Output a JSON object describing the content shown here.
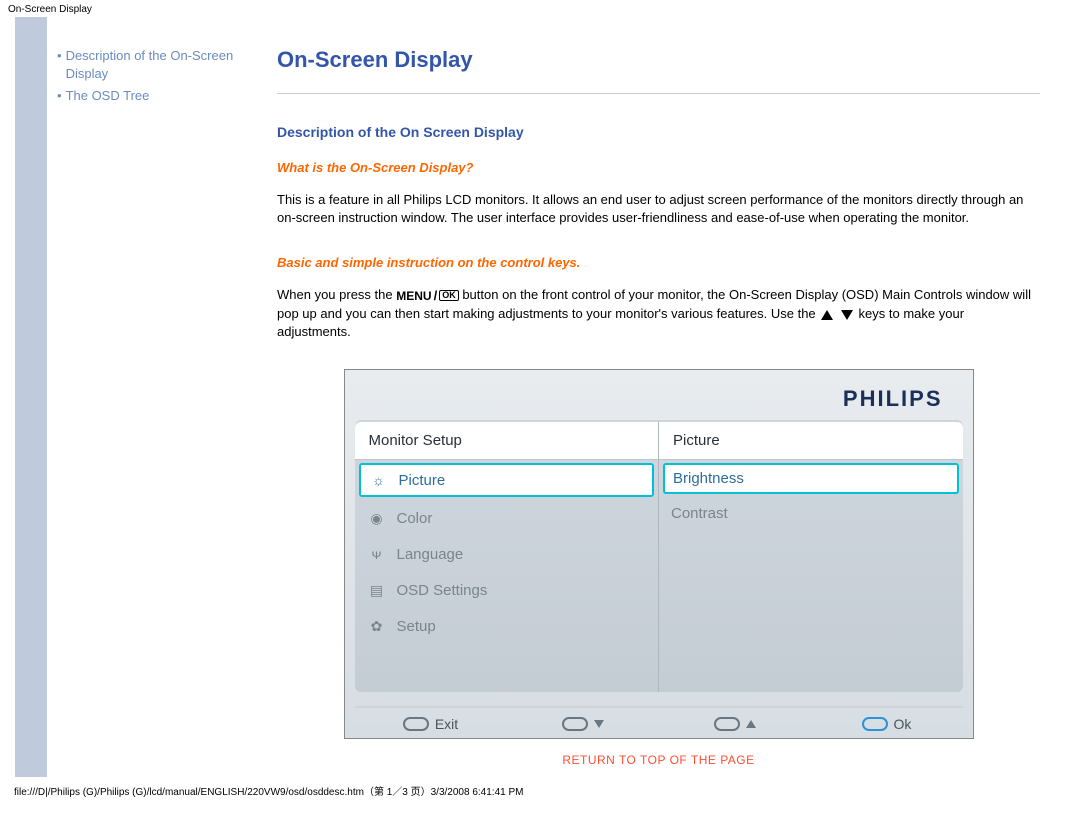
{
  "top_label": "On-Screen Display",
  "sidebar": {
    "items": [
      {
        "label": "Description of the On-Screen Display"
      },
      {
        "label": "The OSD Tree"
      }
    ]
  },
  "main": {
    "title": "On-Screen Display",
    "desc_heading": "Description of the On Screen Display",
    "q1": "What is the On-Screen Display?",
    "p1": "This is a feature in all Philips LCD monitors. It allows an end user to adjust screen performance of the monitors directly through an on-screen instruction window. The user interface provides user-friendliness and ease-of-use when operating the monitor.",
    "q2": "Basic and simple instruction on the control keys.",
    "p2a": "When you press the ",
    "menu_label": "MENU",
    "ok_label": "OK",
    "p2b": " button on the front control of your monitor, the On-Screen Display (OSD) Main Controls window will pop up and you can then start making adjustments to your monitor's various features. Use the ",
    "p2c": " keys to make your adjustments.",
    "return_link": "RETURN TO TOP OF THE PAGE"
  },
  "osd": {
    "logo": "PHILIPS",
    "left_header": "Monitor Setup",
    "right_header": "Picture",
    "left_items": [
      {
        "icon": "brightness-icon",
        "glyph": "☼",
        "label": "Picture",
        "selected": true
      },
      {
        "icon": "color-icon",
        "glyph": "◉",
        "label": "Color",
        "selected": false
      },
      {
        "icon": "language-icon",
        "glyph": "ᴪ",
        "label": "Language",
        "selected": false
      },
      {
        "icon": "osd-settings-icon",
        "glyph": "▤",
        "label": "OSD Settings",
        "selected": false
      },
      {
        "icon": "setup-icon",
        "glyph": "✿",
        "label": "Setup",
        "selected": false
      }
    ],
    "right_items": [
      {
        "label": "Brightness",
        "selected": true
      },
      {
        "label": "Contrast",
        "selected": false
      }
    ],
    "footer": {
      "exit": "Exit",
      "ok": "Ok"
    }
  },
  "footer_path": "file:///D|/Philips (G)/Philips (G)/lcd/manual/ENGLISH/220VW9/osd/osddesc.htm（第 1／3 页）3/3/2008 6:41:41 PM"
}
